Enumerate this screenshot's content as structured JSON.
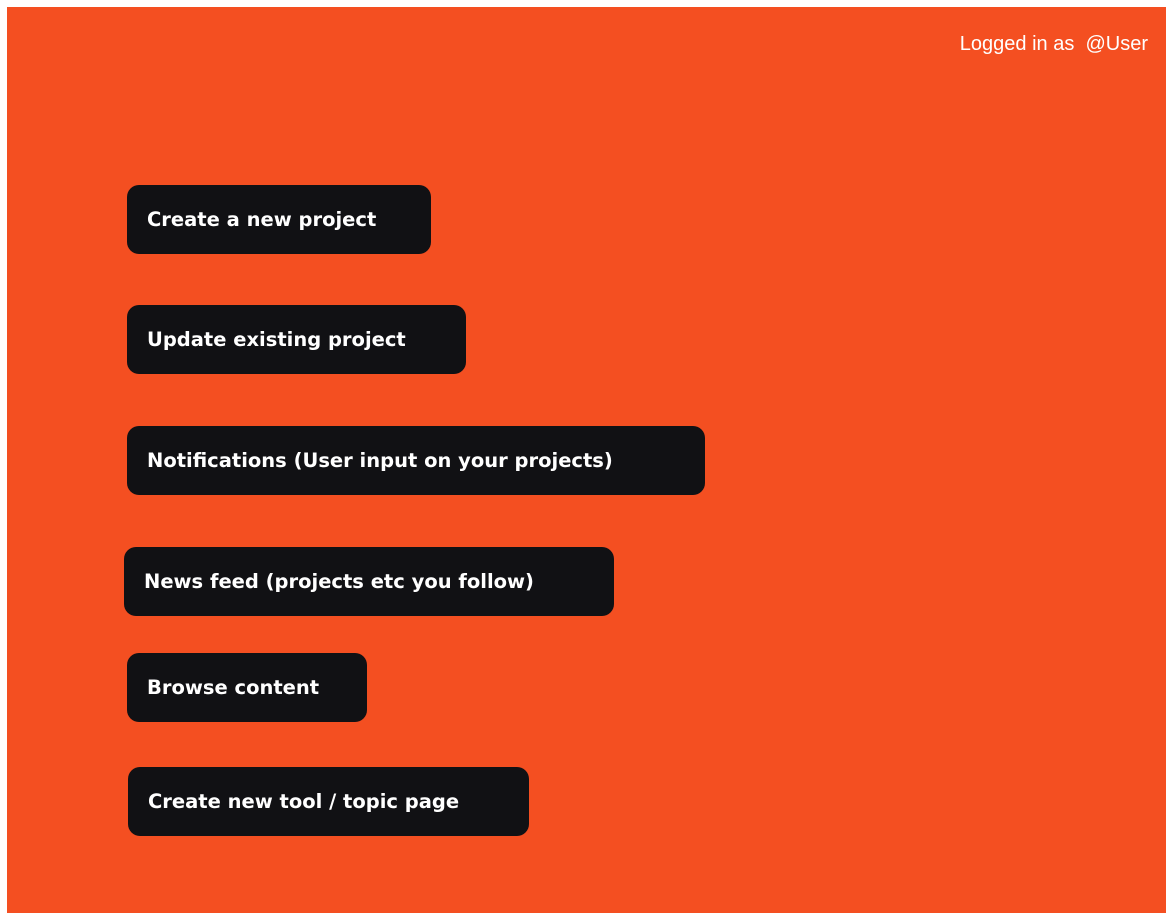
{
  "header": {
    "login_prefix": "Logged in as",
    "username": "@User"
  },
  "colors": {
    "background": "#f44f21",
    "button": "#111114",
    "button_text": "#ffffff"
  },
  "menu": {
    "items": [
      {
        "label": "Create a new project"
      },
      {
        "label": "Update existing project"
      },
      {
        "label": "Notifications (User input on your projects)"
      },
      {
        "label": "News feed (projects etc you follow)"
      },
      {
        "label": "Browse content"
      },
      {
        "label": "Create new tool / topic page"
      }
    ]
  }
}
